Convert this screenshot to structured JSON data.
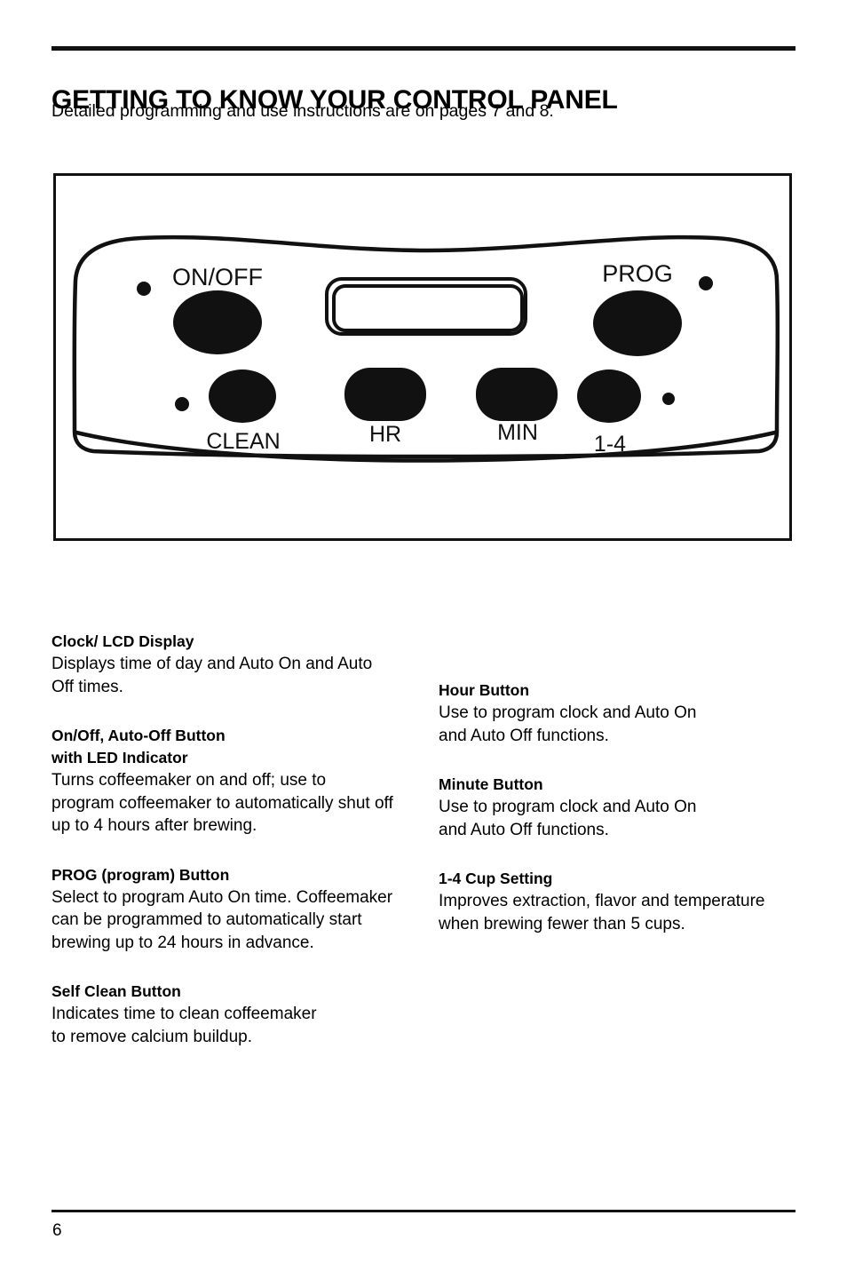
{
  "document": {
    "heading": "GETTING TO KNOW YOUR CONTROL PANEL",
    "subheading": "Detailed programming and use instructions are on pages 7 and 8.",
    "page_number": "6"
  },
  "control_panel": {
    "labels": {
      "on_off": "ON/OFF",
      "prog": "PROG",
      "clean": "CLEAN",
      "hr": "HR",
      "min": "MIN",
      "one_to_four": "1-4"
    },
    "colors": {
      "button_fill": "#111111",
      "outline": "#111111",
      "panel_fill": "#ffffff"
    }
  },
  "descriptions": {
    "left": [
      {
        "title": "Clock/ LCD Display",
        "body": "Displays time of day and Auto On and Auto\nOff times."
      },
      {
        "title": "On/Off, Auto-Off Button\nwith LED Indicator",
        "body": "Turns coffeemaker on and off; use to\nprogram coffeemaker to automatically shut off\nup to 4 hours after brewing."
      },
      {
        "title": "PROG (program) Button",
        "body": "Select to program Auto On time. Coffeemaker\ncan be programmed to automatically start\nbrewing up to 24 hours in advance."
      },
      {
        "title": "Self Clean Button",
        "body": "Indicates time to clean coffeemaker\nto remove calcium buildup."
      }
    ],
    "right": [
      {
        "title": "Hour Button",
        "body": "Use to program clock and Auto On\nand Auto Off functions."
      },
      {
        "title": "Minute Button",
        "body": "Use to program clock and Auto On\n and Auto Off functions."
      },
      {
        "title": "1-4 Cup Setting",
        "body": "Improves extraction, flavor and temperature\nwhen brewing fewer than 5 cups."
      }
    ]
  }
}
